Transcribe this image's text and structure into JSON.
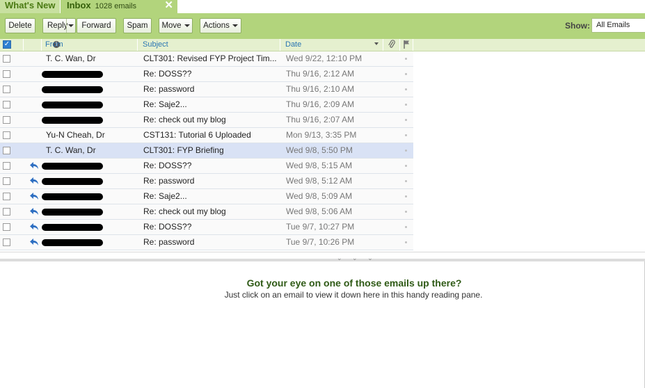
{
  "tabs": [
    {
      "label": "What's New"
    },
    {
      "label": "Inbox",
      "count": "1028 emails",
      "close": "✕"
    }
  ],
  "toolbar": {
    "delete": "Delete",
    "reply": "Reply",
    "forward": "Forward",
    "spam": "Spam",
    "move": "Move",
    "actions": "Actions",
    "show_label": "Show:",
    "show_value": "All Emails"
  },
  "columns": {
    "from": "From",
    "subject": "Subject",
    "date": "Date"
  },
  "emails": [
    {
      "from": "T. C. Wan, Dr",
      "subject": "CLT301: Revised FYP Project Tim...",
      "date": "Wed 9/22, 12:10 PM",
      "redacted": false,
      "replied": false
    },
    {
      "from": "",
      "subject": "Re: DOSS??",
      "date": "Thu 9/16, 2:12 AM",
      "redacted": true,
      "replied": false
    },
    {
      "from": "",
      "subject": "Re: password",
      "date": "Thu 9/16, 2:10 AM",
      "redacted": true,
      "replied": false
    },
    {
      "from": "",
      "subject": "Re: Saje2...",
      "date": "Thu 9/16, 2:09 AM",
      "redacted": true,
      "replied": false
    },
    {
      "from": "",
      "subject": "Re: check out my blog",
      "date": "Thu 9/16, 2:07 AM",
      "redacted": true,
      "replied": false
    },
    {
      "from": "Yu-N Cheah, Dr",
      "subject": "CST131: Tutorial 6 Uploaded",
      "date": "Mon 9/13, 3:35 PM",
      "redacted": false,
      "replied": false
    },
    {
      "from": "T. C. Wan, Dr",
      "subject": "CLT301: FYP Briefing",
      "date": "Wed 9/8, 5:50 PM",
      "redacted": false,
      "replied": false,
      "selected": true
    },
    {
      "from": "",
      "subject": "Re: DOSS??",
      "date": "Wed 9/8, 5:15 AM",
      "redacted": true,
      "replied": true
    },
    {
      "from": "",
      "subject": "Re: password",
      "date": "Wed 9/8, 5:12 AM",
      "redacted": true,
      "replied": true
    },
    {
      "from": "",
      "subject": "Re: Saje2...",
      "date": "Wed 9/8, 5:09 AM",
      "redacted": true,
      "replied": true
    },
    {
      "from": "",
      "subject": "Re: check out my blog",
      "date": "Wed 9/8, 5:06 AM",
      "redacted": true,
      "replied": true
    },
    {
      "from": "",
      "subject": "Re: DOSS??",
      "date": "Tue 9/7, 10:27 PM",
      "redacted": true,
      "replied": true
    },
    {
      "from": "",
      "subject": "Re: password",
      "date": "Tue 9/7, 10:26 PM",
      "redacted": true,
      "replied": true
    }
  ],
  "reading_pane": {
    "title": "Got your eye on one of those emails up there?",
    "subtitle": "Just click on an email to view it down here in this handy reading pane."
  },
  "colors": {
    "accent_green": "#b2d47c",
    "selected_row": "#d9e2f5",
    "link_blue": "#2b76b3"
  }
}
